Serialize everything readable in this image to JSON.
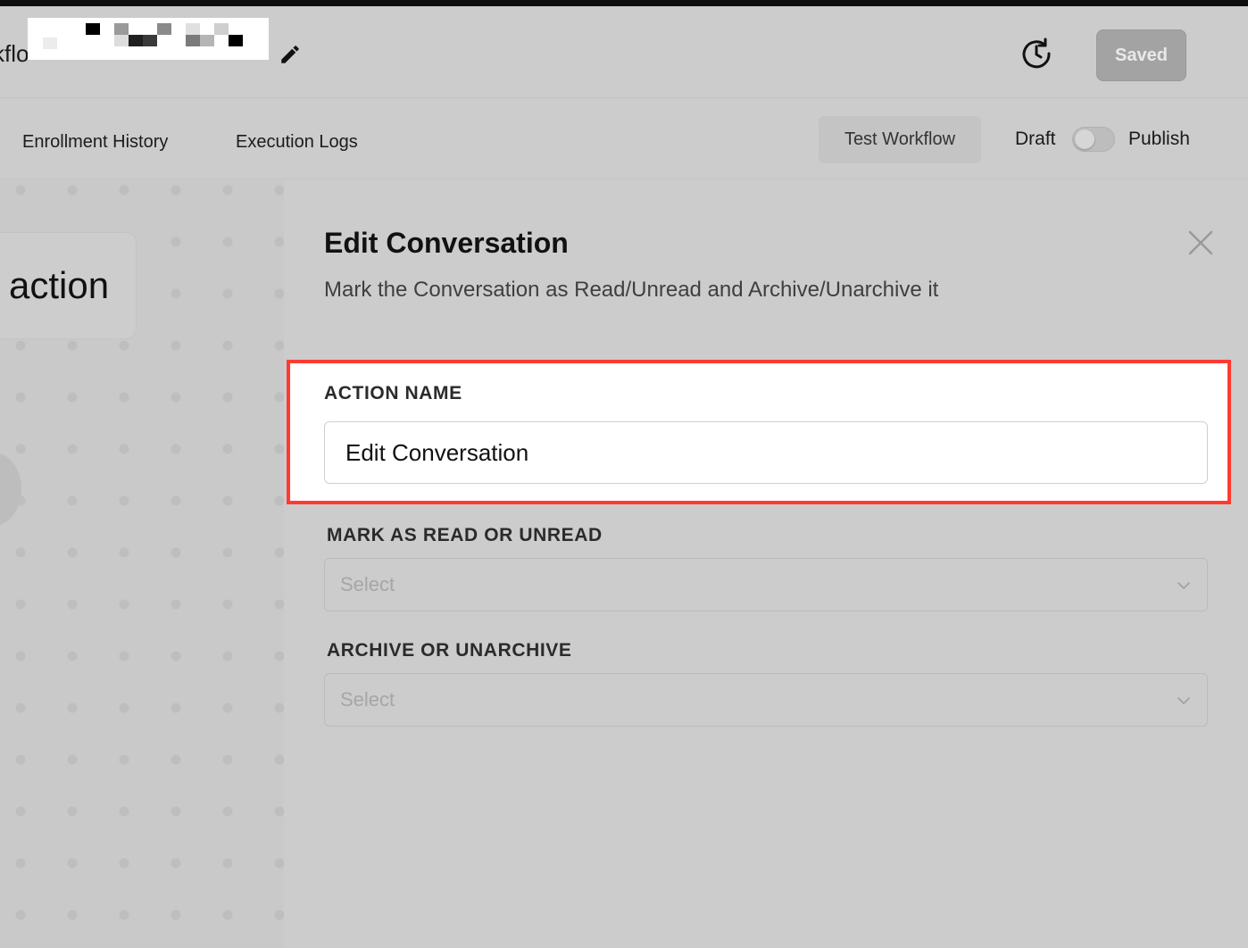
{
  "header": {
    "workflow_title_partial": "kflo",
    "saved_label": "Saved"
  },
  "tabs": [
    {
      "label": "Enrollment History"
    },
    {
      "label": "Execution Logs"
    }
  ],
  "toolbar": {
    "test_workflow_label": "Test Workflow",
    "draft_label": "Draft",
    "publish_label": "Publish",
    "publish_toggle_on": false
  },
  "canvas": {
    "action_node_label": "action"
  },
  "panel": {
    "title": "Edit Conversation",
    "description": "Mark the Conversation as Read/Unread and Archive/Unarchive it",
    "action_name": {
      "label": "ACTION NAME",
      "value": "Edit Conversation"
    },
    "mark_read": {
      "label": "MARK AS READ OR UNREAD",
      "placeholder": "Select"
    },
    "archive": {
      "label": "ARCHIVE OR UNARCHIVE",
      "placeholder": "Select"
    }
  },
  "colors": {
    "highlight_border": "#ff3b30",
    "overlay_gray": "#cccccc"
  }
}
